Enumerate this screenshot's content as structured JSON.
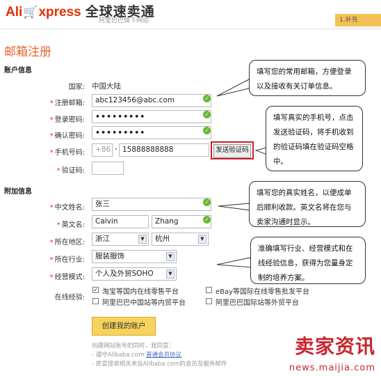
{
  "header": {
    "logo_ali": "Ali",
    "logo_xpress": "xpress",
    "logo_cn": "全球速卖通",
    "sub": "阿里巴巴旗下网站",
    "corner_tab": "1.补充"
  },
  "page_title": "邮箱注册",
  "account": {
    "heading": "账户信息",
    "country_label": "国家:",
    "country_value": "中国大陆",
    "email_label": "注册邮箱:",
    "email_value": "abc123456@abc.com",
    "password_label": "登录密码:",
    "password_value": "•••••••••",
    "confirm_label": "确认密码:",
    "confirm_value": "•••••••••",
    "phone_label": "手机号码:",
    "phone_code": "+86",
    "phone_dash": "-",
    "phone_value": "15888888888",
    "send_code_button": "发送验证码",
    "code_label": "验证码:"
  },
  "extra": {
    "heading": "附加信息",
    "cn_name_label": "中文姓名:",
    "cn_name_value": "张三",
    "en_name_label": "英文名:",
    "first_name": "Calvin",
    "last_name": "Zhang",
    "region_label": "所在地区:",
    "province": "浙江",
    "city": "杭州",
    "industry_label": "所在行业:",
    "industry": "服装服饰",
    "mode_label": "经营模式:",
    "mode": "个人及外贸SOHO",
    "experience_label": "在线经验:",
    "experience_options": [
      {
        "label": "淘宝等国内在线零售平台",
        "checked": true
      },
      {
        "label": "eBay等国际在线零售批发平台",
        "checked": false
      },
      {
        "label": "阿里巴巴中国站等内贸平台",
        "checked": false
      },
      {
        "label": "阿里巴巴国际站等外贸平台",
        "checked": false
      }
    ]
  },
  "create_button": "创建我的账户",
  "fine_print": {
    "line1": "创建网站账号的同时，我同意：",
    "line2_prefix": "- 遵守Alibaba.com ",
    "line2_link": "普通会员协议",
    "line3": "- 愿意接收相关来自Alibaba.com的会员及服务邮件"
  },
  "tips": {
    "email": "填写您的常用邮箱，方便登录以及接收有关订单信息。",
    "phone": "填写真实的手机号，点击发送验证码，将手机收到的验证码填在验证码空格中。",
    "name": "填写您的真实姓名，以便成单后顺利收款。英文名将在您与卖家沟通时显示。",
    "business": "准确填写行业、经营模式和在线经验信息，获得为您量身定制的培养方案。"
  },
  "watermark": {
    "title": "卖家资讯",
    "url": "news.maijia.com"
  },
  "colors": {
    "brand": "#e62e04",
    "title": "#e8642a",
    "check": "#6ab82e",
    "highlight": "#c8202a",
    "button": "#f7d35c"
  }
}
